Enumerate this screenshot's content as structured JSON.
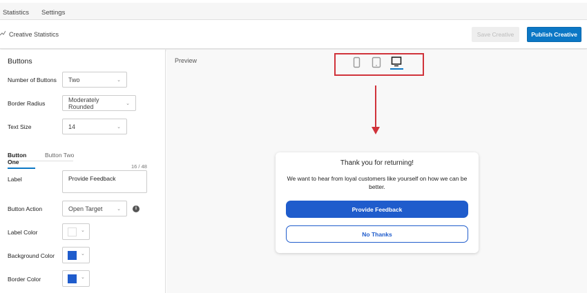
{
  "topnav": {
    "tabs": [
      "Statistics",
      "Settings"
    ]
  },
  "toolbar": {
    "title": "Creative Statistics",
    "save_label": "Save Creative",
    "publish_label": "Publish Creative"
  },
  "panel": {
    "title": "Buttons",
    "number_of_buttons": {
      "label": "Number of Buttons",
      "value": "Two"
    },
    "border_radius": {
      "label": "Border Radius",
      "value": "Moderately Rounded"
    },
    "text_size": {
      "label": "Text Size",
      "value": "14"
    },
    "tabs": [
      "Button One",
      "Button Two"
    ],
    "label_field": {
      "label": "Label",
      "value": "Provide Feedback",
      "counter": "16 / 48"
    },
    "button_action": {
      "label": "Button Action",
      "value": "Open Target"
    },
    "label_color": {
      "label": "Label Color",
      "value": "#ffffff"
    },
    "background_color": {
      "label": "Background Color",
      "value": "#1f5ccc"
    },
    "border_color": {
      "label": "Border Color",
      "value": "#1f5ccc"
    }
  },
  "preview": {
    "title": "Preview",
    "devices": [
      "mobile",
      "tablet",
      "desktop"
    ],
    "selected_device": "desktop",
    "card": {
      "heading": "Thank you for returning!",
      "body": "We want to hear from loyal customers like yourself on how we can be better.",
      "primary": "Provide Feedback",
      "secondary": "No Thanks"
    }
  },
  "colors": {
    "accent": "#0b77c5",
    "button_blue": "#1f5ccc",
    "annotation_red": "#d0323a"
  }
}
